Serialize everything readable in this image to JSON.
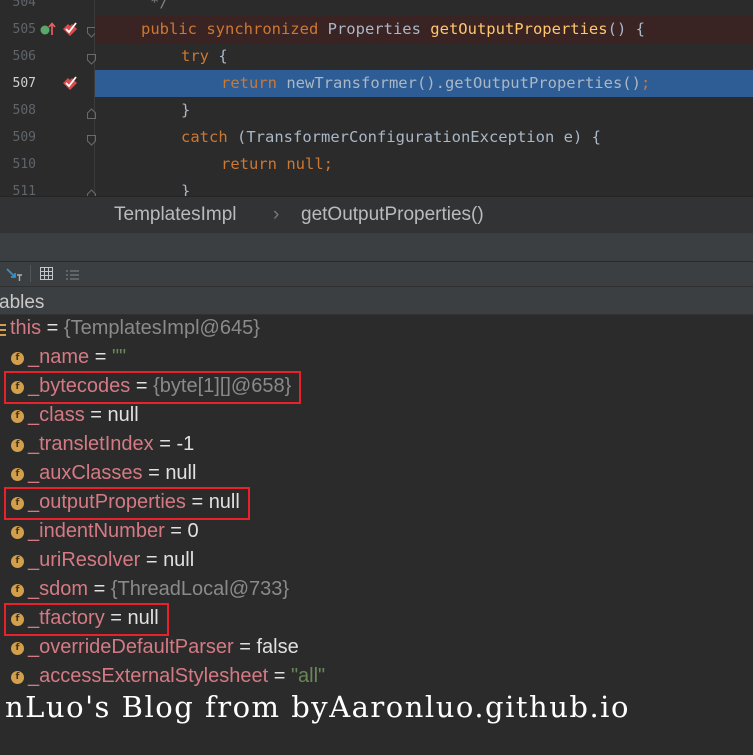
{
  "editor": {
    "lines": [
      {
        "num": "504",
        "parts": [
          {
            "t": "*/",
            "c": "cm"
          }
        ]
      },
      {
        "num": "505",
        "parts": [
          {
            "t": "public synchronized ",
            "c": "kw"
          },
          {
            "t": "Properties ",
            "c": ""
          },
          {
            "t": "getOutputProperties",
            "c": "fn"
          },
          {
            "t": "() {",
            "c": ""
          }
        ]
      },
      {
        "num": "506",
        "parts": [
          {
            "t": "try ",
            "c": "kw"
          },
          {
            "t": "{",
            "c": ""
          }
        ]
      },
      {
        "num": "507",
        "parts": [
          {
            "t": "return ",
            "c": "kw"
          },
          {
            "t": "newTransformer().getOutputProperties()",
            "c": ""
          },
          {
            "t": ";",
            "c": "kw"
          }
        ]
      },
      {
        "num": "508",
        "parts": [
          {
            "t": "}",
            "c": ""
          }
        ]
      },
      {
        "num": "509",
        "parts": [
          {
            "t": "catch ",
            "c": "kw"
          },
          {
            "t": "(TransformerConfigurationException e) {",
            "c": ""
          }
        ]
      },
      {
        "num": "510",
        "parts": [
          {
            "t": "return null",
            "c": "kw"
          },
          {
            "t": ";",
            "c": "kw"
          }
        ]
      },
      {
        "num": "511",
        "parts": [
          {
            "t": "}",
            "c": ""
          }
        ]
      }
    ]
  },
  "breadcrumb": {
    "class_name": "TemplatesImpl",
    "separator": "›",
    "method_name": "getOutputProperties()"
  },
  "debug": {
    "variables_label": "ables",
    "this_row": {
      "name": "this",
      "eq": " = ",
      "value": "{TemplatesImpl@645}"
    },
    "fields": [
      {
        "name": "_name",
        "value": "\"\"",
        "style": "green"
      },
      {
        "name": "_bytecodes",
        "value": "{byte[1][]@658}",
        "style": "gray",
        "highlighted": true
      },
      {
        "name": "_class",
        "value": "null",
        "style": "white"
      },
      {
        "name": "_transletIndex",
        "value": "-1",
        "style": "white"
      },
      {
        "name": "_auxClasses",
        "value": "null",
        "style": "white"
      },
      {
        "name": "_outputProperties",
        "value": "null",
        "style": "white",
        "highlighted": true
      },
      {
        "name": "_indentNumber",
        "value": "0",
        "style": "white"
      },
      {
        "name": "_uriResolver",
        "value": "null",
        "style": "white"
      },
      {
        "name": "_sdom",
        "value": "{ThreadLocal@733}",
        "style": "gray"
      },
      {
        "name": "_tfactory",
        "value": "null",
        "style": "white",
        "highlighted": true
      },
      {
        "name": "_overrideDefaultParser",
        "value": "false",
        "style": "white"
      },
      {
        "name": "_accessExternalStylesheet",
        "value": "\"all\"",
        "style": "green"
      }
    ],
    "field_icon_letter": "f"
  },
  "watermark": "nLuo's Blog from byAaronluo.github.io",
  "colors": {
    "keyword": "#cc7832",
    "method": "#ffc66d",
    "field_name": "#d57a84",
    "highlight_box": "#e8212a",
    "current_line": "#2d5d94"
  }
}
